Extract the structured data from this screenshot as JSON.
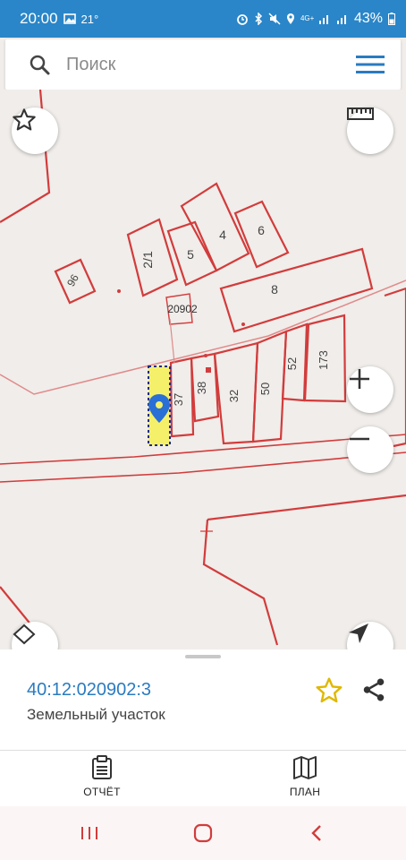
{
  "status_bar": {
    "time": "20:00",
    "temperature": "21°",
    "network": "4G+",
    "battery": "43%"
  },
  "search": {
    "placeholder": "Поиск",
    "icon": "search-icon",
    "menu_icon": "hamburger-menu-icon"
  },
  "map": {
    "parcel_labels": [
      "2/1",
      "5",
      "4",
      "6",
      "8",
      "96",
      "37",
      "38",
      "32",
      "50",
      "52",
      "173"
    ],
    "quarter_label": "20902",
    "colors": {
      "boundary": "#d23c3c",
      "selected_fill": "#f4f06a",
      "selected_outline": "#1a2a8a",
      "pin": "#2a6fd6",
      "background": "#f0edea"
    },
    "controls": [
      "favorite-star-icon",
      "ruler-icon",
      "zoom-in-icon",
      "zoom-out-icon",
      "layers-icon",
      "locate-arrow-icon"
    ]
  },
  "parcel": {
    "cadastral_number": "40:12:020902:3",
    "type": "Земельный участок",
    "colors": {
      "link": "#2a7bc0",
      "star": "#e0b800"
    }
  },
  "tabs": [
    {
      "label": "ОТЧЁТ",
      "icon": "report-clipboard-icon"
    },
    {
      "label": "ПЛАН",
      "icon": "plan-map-icon"
    }
  ],
  "nav": [
    "recent-apps-icon",
    "home-icon",
    "back-icon"
  ]
}
